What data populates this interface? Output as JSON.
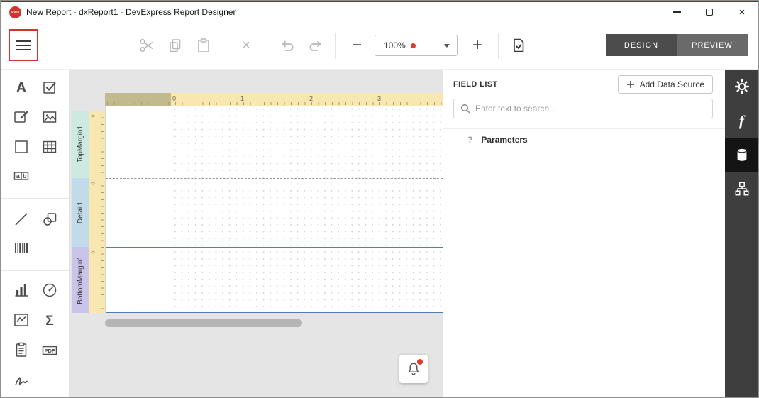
{
  "window": {
    "title": "New Report - dxReport1 - DevExpress Report Designer",
    "logo_text": "RAD"
  },
  "toolbar": {
    "zoom_value": "100%",
    "design_label": "DESIGN",
    "preview_label": "PREVIEW"
  },
  "toolbox": {
    "items": [
      "label",
      "checkbox",
      "rich-text",
      "picture-box",
      "panel",
      "table",
      "character-comb",
      "line",
      "shape",
      "barcode",
      "chart",
      "gauge",
      "sparkline",
      "pivot-grid",
      "page-info",
      "pdf-content",
      "signature"
    ],
    "glyphs": {
      "label": "A",
      "comb_a": "a",
      "comb_b": "b",
      "pivot": "Σ",
      "pdf": "PDF"
    }
  },
  "designer": {
    "ruler_ticks": [
      "0",
      "1",
      "2",
      "3"
    ],
    "vertical_zero": "0",
    "bands": [
      {
        "label": "TopMargin1",
        "color": "#cdeae2"
      },
      {
        "label": "Detail1",
        "color": "#c2dbeb"
      },
      {
        "label": "BottomMargin1",
        "color": "#c9c5ea"
      }
    ]
  },
  "field_list": {
    "title": "FIELD LIST",
    "add_data_source": "Add Data Source",
    "search_placeholder": "Enter text to search...",
    "parameters_icon": "?",
    "parameters": "Parameters"
  },
  "rightbar": {
    "fx_glyph": "f",
    "items": [
      "properties",
      "expressions",
      "field-list",
      "report-explorer"
    ],
    "selected": "field-list"
  },
  "colors": {
    "accent_red": "#d0342c",
    "band_line_blue": "#4e7fae",
    "ruler_tan": "#f8e7b0",
    "ruler_margin": "#c2ba8d",
    "sidebar_dark": "#3e3e3e",
    "sidebar_selected": "#141414"
  }
}
